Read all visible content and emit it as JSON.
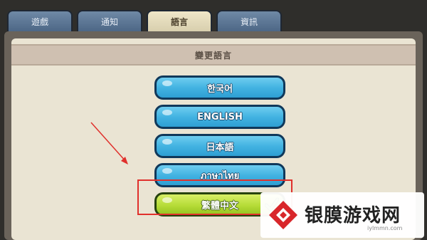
{
  "tabs": [
    {
      "label": "遊戲",
      "active": false
    },
    {
      "label": "通知",
      "active": false
    },
    {
      "label": "語言",
      "active": true
    },
    {
      "label": "資訊",
      "active": false
    }
  ],
  "section_title": "變更語言",
  "languages": [
    {
      "label": "한국어",
      "selected": false
    },
    {
      "label": "ENGLISH",
      "selected": false
    },
    {
      "label": "日本語",
      "selected": false
    },
    {
      "label": "ภาษาไทย",
      "selected": false
    },
    {
      "label": "繁體中文",
      "selected": true
    }
  ],
  "watermark": {
    "text": "银膜游戏网",
    "url": "iylmmn.com"
  },
  "colors": {
    "button_blue": "#43b3e2",
    "button_green": "#b6dc38",
    "annotation_red": "#e0302c"
  }
}
